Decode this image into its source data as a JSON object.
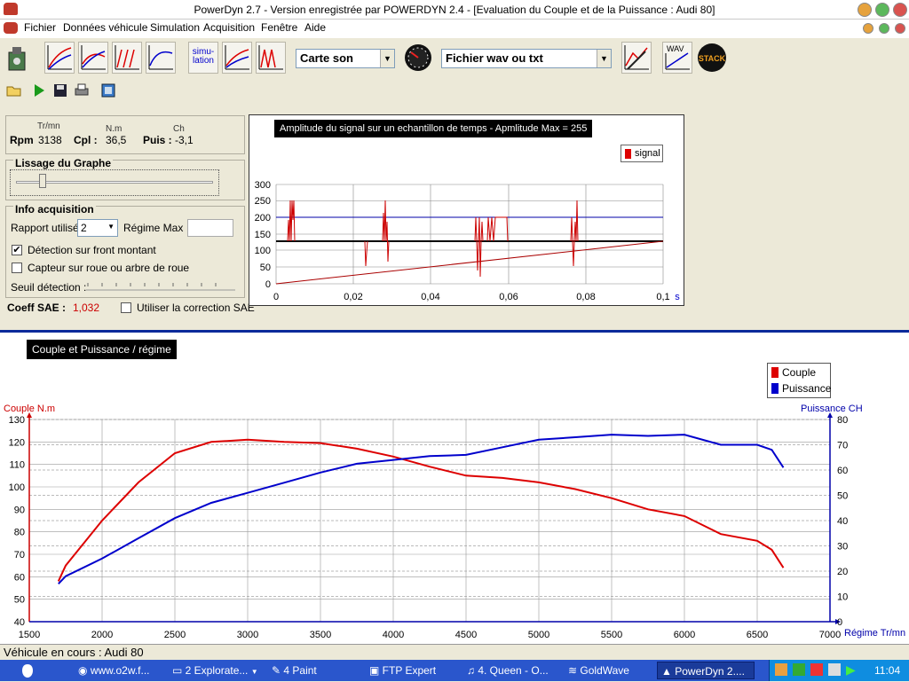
{
  "window": {
    "title": "PowerDyn 2.7 - Version enregistrée par POWERDYN 2.4 - [Evaluation du Couple et de la Puissance : Audi 80]"
  },
  "menu": {
    "items": [
      "Fichier",
      "Données véhicule",
      "Simulation",
      "Acquisition",
      "Fenêtre",
      "Aide"
    ]
  },
  "toolbar": {
    "simulation_label": "simu-\nlation",
    "sound_card": "Carte son",
    "file_type": "Fichier wav ou txt",
    "wav_label": "WAV",
    "stack_label": "STACK"
  },
  "readout": {
    "rpm_unit": "Tr/mn",
    "rpm_label": "Rpm",
    "rpm_value": "3138",
    "cpl_unit": "N.m",
    "cpl_label": "Cpl :",
    "cpl_value": "36,5",
    "puis_unit": "Ch",
    "puis_label": "Puis :",
    "puis_value": "-3,1"
  },
  "smoothing": {
    "title": "Lissage du Graphe"
  },
  "acquisition": {
    "title": "Info acquisition",
    "rapport_label": "Rapport utilisé",
    "rapport_value": "2",
    "regime_max_label": "Régime Max",
    "regime_max_value": "",
    "detect_front": "Détection sur front montant",
    "detect_front_checked": true,
    "capteur_roue": "Capteur sur roue ou arbre de roue",
    "capteur_roue_checked": false,
    "seuil_label": "Seuil détection :"
  },
  "sae": {
    "label": "Coeff SAE :",
    "value": "1,032",
    "use_label": "Utiliser la correction SAE",
    "checked": false
  },
  "signal_chart": {
    "title": "Amplitude du signal sur un echantillon de temps - Apmlitude Max = 255",
    "legend": "signal",
    "unit": "s",
    "x_ticks": [
      "0",
      "0,02",
      "0,04",
      "0,06",
      "0,08",
      "0,1"
    ],
    "y_ticks": [
      "0",
      "50",
      "100",
      "150",
      "200",
      "250",
      "300"
    ]
  },
  "main_chart_title": "Couple et Puissance / régime",
  "chart_data": {
    "type": "line",
    "title": "Couple et Puissance / régime",
    "xlabel": "Régime Tr/mn",
    "ylabel": "Couple N.m",
    "y2label": "Puissance CH",
    "xlim": [
      1500,
      7000
    ],
    "ylim": [
      40,
      130
    ],
    "y2lim": [
      0,
      80
    ],
    "x_ticks": [
      1500,
      2000,
      2500,
      3000,
      3500,
      4000,
      4500,
      5000,
      5500,
      6000,
      6500,
      7000
    ],
    "y_ticks": [
      40,
      50,
      60,
      70,
      80,
      90,
      100,
      110,
      120,
      130
    ],
    "y2_ticks": [
      0,
      10,
      20,
      30,
      40,
      50,
      60,
      70,
      80
    ],
    "legend_position": "top-right",
    "series": [
      {
        "name": "Couple",
        "color": "#dd0000",
        "axis": "left",
        "x": [
          1700,
          1750,
          2000,
          2250,
          2500,
          2750,
          3000,
          3250,
          3500,
          3750,
          4000,
          4250,
          4500,
          4750,
          5000,
          5250,
          5500,
          5750,
          6000,
          6250,
          6500,
          6600,
          6680
        ],
        "y": [
          58,
          65,
          85,
          102,
          115,
          120,
          121,
          120,
          119.5,
          117,
          113.5,
          109,
          105,
          104,
          102,
          99,
          95,
          90,
          87,
          79,
          76,
          72,
          64
        ]
      },
      {
        "name": "Puissance",
        "color": "#0000cc",
        "axis": "right",
        "x": [
          1700,
          1750,
          2000,
          2250,
          2500,
          2750,
          3000,
          3250,
          3500,
          3750,
          4000,
          4250,
          4500,
          4750,
          5000,
          5250,
          5500,
          5750,
          6000,
          6250,
          6500,
          6600,
          6680
        ],
        "y": [
          15,
          18,
          25,
          33,
          41,
          47,
          51,
          55,
          59,
          62.5,
          64,
          65.5,
          66,
          69,
          72,
          73,
          74,
          73.5,
          74,
          70,
          70,
          68,
          61
        ]
      }
    ]
  },
  "status": {
    "text": "Véhicule en cours : Audi 80"
  },
  "taskbar": {
    "items": [
      "www.o2w.f...",
      "2 Explorate...",
      "4 Paint",
      "FTP Expert",
      "4. Queen - O...",
      "GoldWave",
      "PowerDyn 2...."
    ],
    "clock": "11:04"
  },
  "colors": {
    "accent_blue": "#0b2a9a",
    "couple": "#dd0000",
    "puissance": "#0000cc",
    "taskbar": "#2a56cc"
  }
}
